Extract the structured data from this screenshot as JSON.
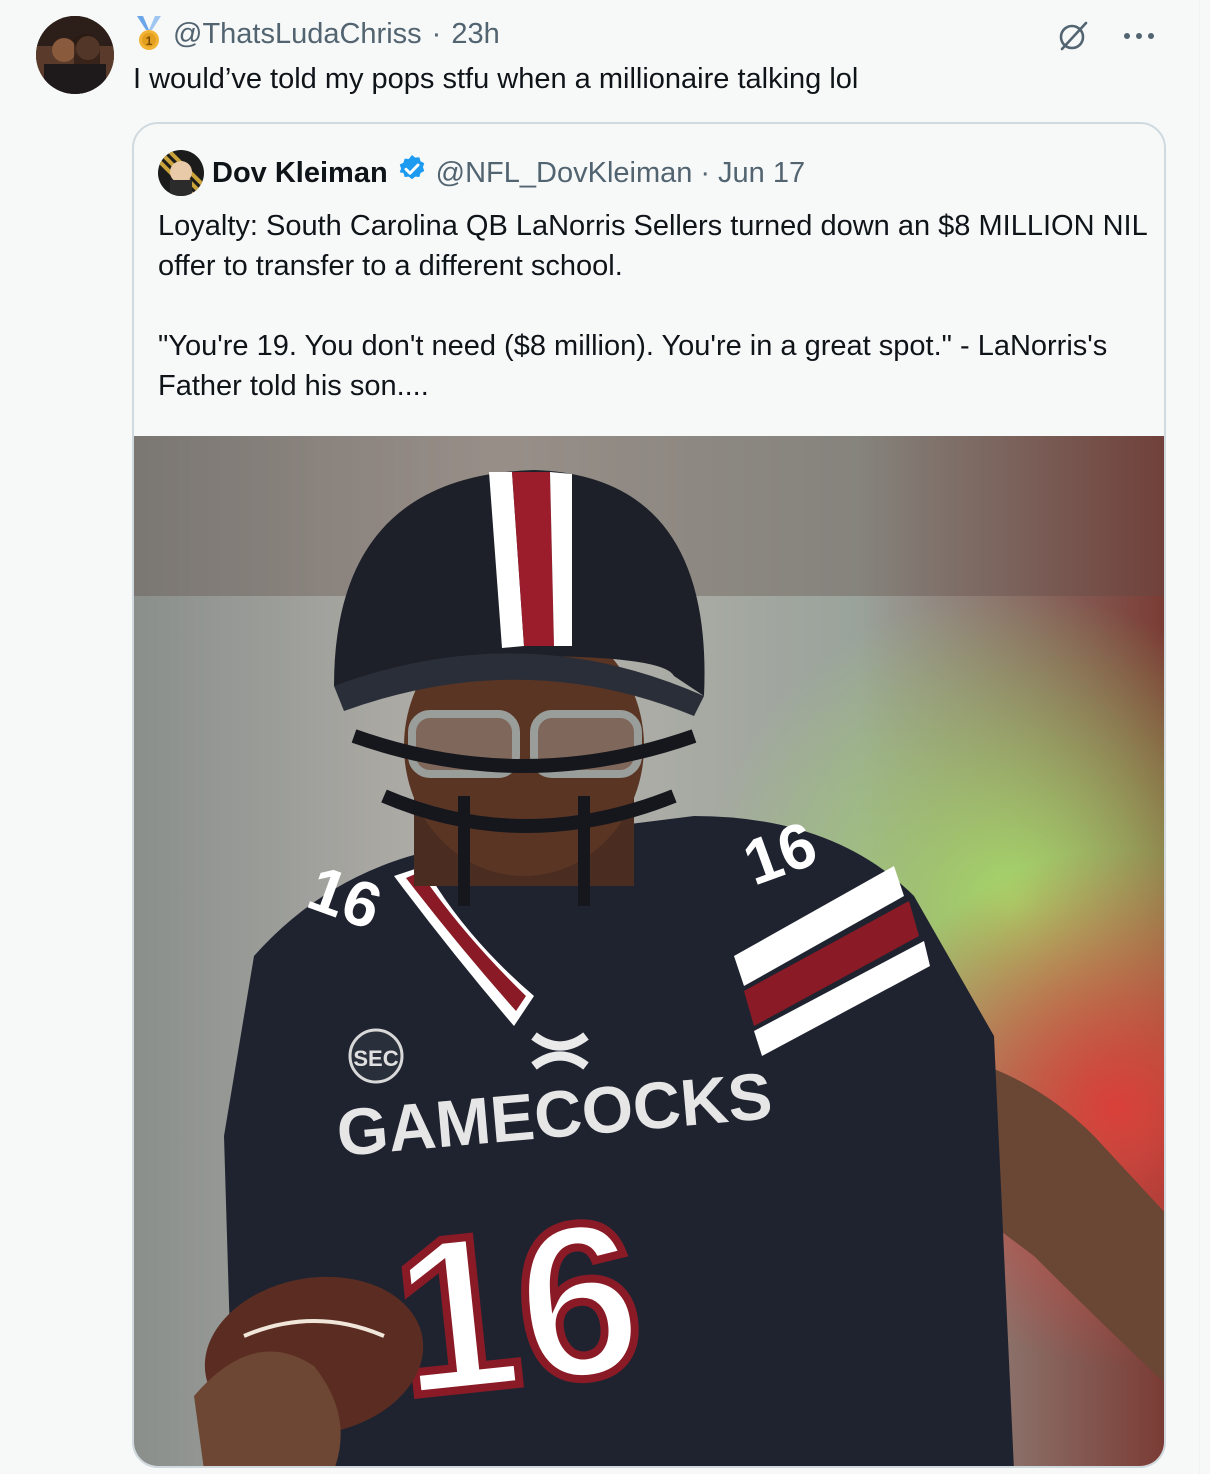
{
  "tweet": {
    "handle": "@ThatsLudaChriss",
    "separator": "·",
    "time": "23h",
    "text": "I would’ve told my pops stfu when a millionaire talking lol"
  },
  "quoted": {
    "name": "Dov Kleiman",
    "handle": "@NFL_DovKleiman",
    "separator": "·",
    "date": "Jun 17",
    "paragraph1": "Loyalty: South Carolina QB LaNorris Sellers turned down an $8 MILLION NIL offer to transfer to a different school.",
    "paragraph2": "\"You're 19. You don't need ($8 million). You're in a great spot.\" - LaNorris's Father told his son....",
    "photo": {
      "jersey_number": "16",
      "chest_text": "GAMECOCKS",
      "patch_text": "SEC"
    }
  },
  "icons": [
    "grok-icon",
    "more-options-icon",
    "verified-badge-icon",
    "subscriber-badge-icon"
  ],
  "colors": {
    "verified_blue": "#1d9bf0",
    "secondary_text": "#536471",
    "border": "#cfd9de"
  }
}
